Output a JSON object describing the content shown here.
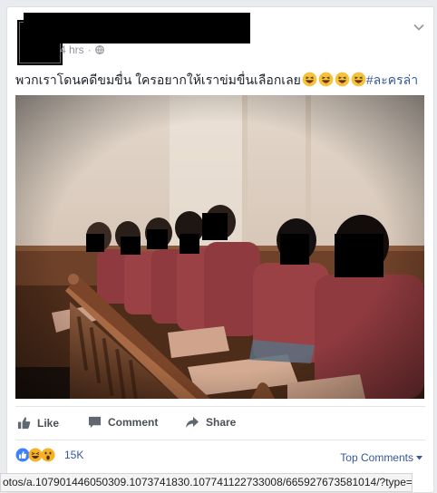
{
  "post": {
    "time": "4 hrs",
    "privacy_icon": "globe-icon",
    "text": "พวกเราโดนคดีขมขื่น ใครอยากให้เราข่มขื่นเลือกเลย",
    "hashtag": "#ละครล่า",
    "emoji_count": 4
  },
  "actions": {
    "like": "Like",
    "comment": "Comment",
    "share": "Share"
  },
  "reactions": {
    "icons": [
      "like-reaction-icon",
      "haha-reaction-icon",
      "wow-reaction-icon"
    ],
    "count": "15K",
    "top_comments": "Top Comments"
  },
  "statusbar": {
    "url": "otos/a.107901446050309.1073741830.107741122733008/665927673581014/?type=3"
  },
  "colors": {
    "link": "#365899",
    "muted": "#90949c",
    "action_text": "#4b4f56",
    "robe": "#8e3a3e"
  }
}
